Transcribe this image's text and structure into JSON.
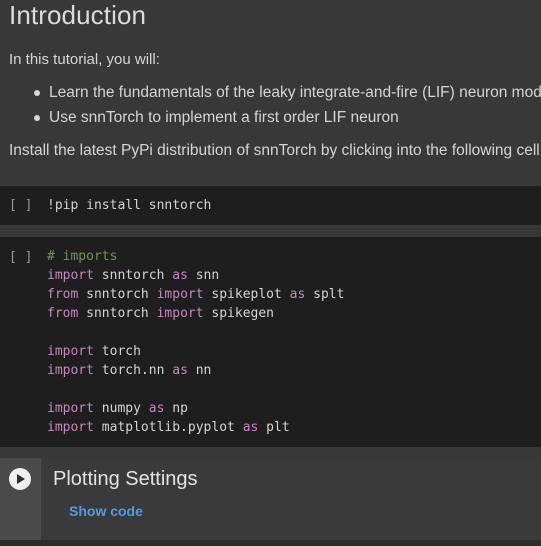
{
  "markdown": {
    "heading": "Introduction",
    "intro": "In this tutorial, you will:",
    "bullets": [
      "Learn the fundamentals of the leaky integrate-and-fire (LIF) neuron model",
      "Use snnTorch to implement a first order LIF neuron"
    ],
    "install_text": "Install the latest PyPi distribution of snnTorch by clicking into the following cell"
  },
  "cells": {
    "run_bracket": "[ ]",
    "cell1": {
      "line": "!pip install snntorch"
    },
    "cell2": {
      "comment": "# imports",
      "lines": [
        {
          "k1": "import",
          "t1": " snntorch ",
          "k2": "as",
          "t2": " snn"
        },
        {
          "k1": "from",
          "t1": " snntorch ",
          "k2": "import",
          "t2": " spikeplot ",
          "k3": "as",
          "t3": " splt"
        },
        {
          "k1": "from",
          "t1": " snntorch ",
          "k2": "import",
          "t2": " spikegen"
        },
        {
          "k1": "import",
          "t1": " torch"
        },
        {
          "k1": "import",
          "t1": " torch.nn ",
          "k2": "as",
          "t2": " nn"
        },
        {
          "k1": "import",
          "t1": " numpy ",
          "k2": "as",
          "t2": " np"
        },
        {
          "k1": "import",
          "t1": " matplotlib.pyplot ",
          "k2": "as",
          "t2": " plt"
        }
      ]
    }
  },
  "form": {
    "title": "Plotting Settings",
    "show_code": "Show code",
    "play_icon": "play-icon"
  }
}
